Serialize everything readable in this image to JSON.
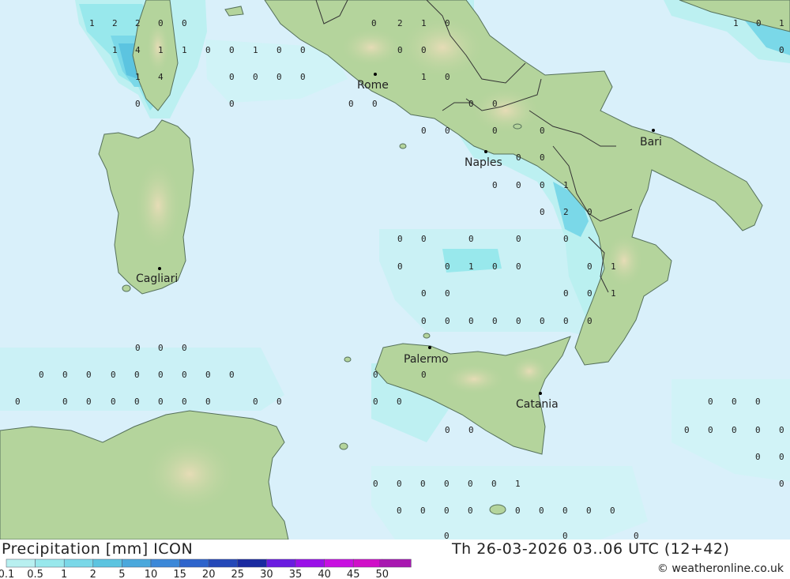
{
  "footer": {
    "title": "Precipitation [mm] ICON",
    "datetime": "Th 26-03-2026 03..06 UTC (12+42)",
    "copyright": "© weatheronline.co.uk",
    "legend": [
      {
        "label": "0.1",
        "color": "#b8f0f0"
      },
      {
        "label": "0.5",
        "color": "#98e8ec"
      },
      {
        "label": "1",
        "color": "#7ad8e8"
      },
      {
        "label": "2",
        "color": "#5cc4e0"
      },
      {
        "label": "5",
        "color": "#4aa8dc"
      },
      {
        "label": "10",
        "color": "#3c88d8"
      },
      {
        "label": "15",
        "color": "#2e64cc"
      },
      {
        "label": "20",
        "color": "#2448b8"
      },
      {
        "label": "25",
        "color": "#1a2aa0"
      },
      {
        "label": "30",
        "color": "#6a1ce0"
      },
      {
        "label": "35",
        "color": "#9a10e8"
      },
      {
        "label": "40",
        "color": "#c810e0"
      },
      {
        "label": "45",
        "color": "#d010c8"
      },
      {
        "label": "50",
        "color": "#a818b0"
      }
    ]
  },
  "cities": [
    {
      "name": "Rome"
    },
    {
      "name": "Naples"
    },
    {
      "name": "Bari"
    },
    {
      "name": "Cagliari"
    },
    {
      "name": "Palermo"
    },
    {
      "name": "Catania"
    }
  ],
  "grid_values": [
    "1",
    "2",
    "2",
    "0",
    "0",
    "0",
    "2",
    "1",
    "0",
    "1",
    "0",
    "1",
    "1",
    "4",
    "1",
    "1",
    "0",
    "0",
    "1",
    "0",
    "0",
    "0",
    "0",
    "0",
    "1",
    "4",
    "0",
    "0",
    "0",
    "0",
    "1",
    "0",
    "0",
    "0",
    "0",
    "0",
    "0",
    "0",
    "0",
    "0",
    "0",
    "0",
    "0",
    "0",
    "0",
    "0",
    "0",
    "1",
    "0",
    "2",
    "0",
    "0",
    "0",
    "0",
    "0",
    "0",
    "0",
    "0",
    "1",
    "0",
    "0",
    "0",
    "1",
    "0",
    "0",
    "0",
    "0",
    "1",
    "0",
    "0",
    "0",
    "0",
    "0",
    "0",
    "0",
    "0",
    "0",
    "0",
    "0",
    "0",
    "0",
    "0",
    "0",
    "0",
    "0",
    "0",
    "0",
    "0",
    "0",
    "0",
    "0",
    "0",
    "0",
    "0",
    "0",
    "0",
    "0",
    "0",
    "0",
    "0",
    "0",
    "0",
    "0",
    "0",
    "0",
    "0",
    "0",
    "0",
    "0",
    "0",
    "0",
    "0",
    "0",
    "0",
    "0",
    "0",
    "0",
    "0",
    "0",
    "0",
    "0",
    "0",
    "1",
    "0",
    "0",
    "0",
    "0",
    "0",
    "0",
    "0",
    "0",
    "0",
    "0",
    "0",
    "0",
    "0"
  ],
  "colors": {
    "sea": "#d9f0fa",
    "land": "#b4d49c",
    "land_highlight": "#e8dcb8",
    "precip_light": "#b8f0f0",
    "precip_mid": "#7ad8e8",
    "precip_heavy": "#4aa8dc"
  }
}
